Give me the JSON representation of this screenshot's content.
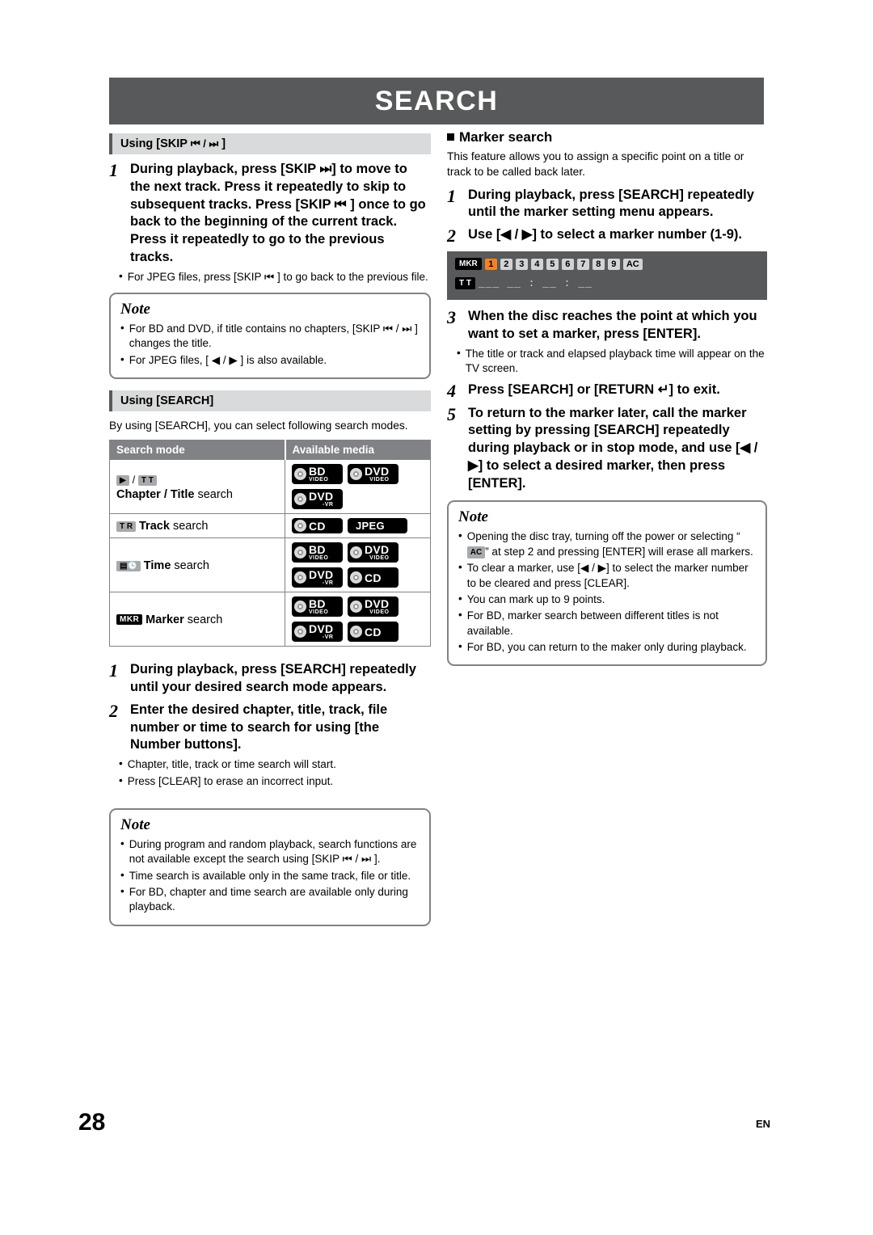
{
  "page": {
    "title": "SEARCH",
    "number": "28",
    "lang": "EN"
  },
  "left": {
    "section1": {
      "heading_prefix": "Using [SKIP",
      "heading_icons": "⏮ / ⏭",
      "heading_suffix": "]",
      "step1_num": "1",
      "step1_text": "During playback, press [SKIP ⏭] to move to the next track. Press it repeatedly to skip to subsequent tracks. Press [SKIP ⏮ ] once to go back to the beginning of the current track. Press it repeatedly to go to the previous tracks.",
      "bullet1": "For JPEG files, press [SKIP ⏮ ] to go back to the previous file.",
      "note_title": "Note",
      "note_b1": "For BD and DVD, if title contains no chapters, [SKIP ⏮ / ⏭ ] changes the title.",
      "note_b2": "For JPEG files, [ ◀ / ▶ ] is also available."
    },
    "section2": {
      "heading": "Using [SEARCH]",
      "intro": "By using [SEARCH], you can select following search modes.",
      "table": {
        "col1": "Search mode",
        "col2": "Available media",
        "rows": [
          {
            "icons": [
              "play",
              "TT"
            ],
            "label_bold": "Chapter / Title",
            "label_norm": "search",
            "media": [
              {
                "type": "disc",
                "big": "BD",
                "sub": "VIDEO"
              },
              {
                "type": "disc",
                "big": "DVD",
                "sub": "VIDEO"
              },
              {
                "type": "disc",
                "big": "DVD",
                "sub": "-VR"
              }
            ]
          },
          {
            "icons": [
              "TR"
            ],
            "label_bold": "Track",
            "label_norm": "search",
            "media": [
              {
                "type": "disc",
                "big": "CD",
                "sub": ""
              },
              {
                "type": "plain",
                "big": "JPEG",
                "sub": ""
              }
            ]
          },
          {
            "icons": [
              "time"
            ],
            "label_bold": "Time",
            "label_norm": "search",
            "media": [
              {
                "type": "disc",
                "big": "BD",
                "sub": "VIDEO"
              },
              {
                "type": "disc",
                "big": "DVD",
                "sub": "VIDEO"
              },
              {
                "type": "disc",
                "big": "DVD",
                "sub": "-VR"
              },
              {
                "type": "disc",
                "big": "CD",
                "sub": ""
              }
            ]
          },
          {
            "icons": [
              "MKR"
            ],
            "label_bold": "Marker",
            "label_norm": "search",
            "media": [
              {
                "type": "disc",
                "big": "BD",
                "sub": "VIDEO"
              },
              {
                "type": "disc",
                "big": "DVD",
                "sub": "VIDEO"
              },
              {
                "type": "disc",
                "big": "DVD",
                "sub": "-VR"
              },
              {
                "type": "disc",
                "big": "CD",
                "sub": ""
              }
            ]
          }
        ]
      },
      "step1_num": "1",
      "step1_text": "During playback, press [SEARCH] repeatedly until your desired search mode appears.",
      "step2_num": "2",
      "step2_text": "Enter the desired chapter, title, track, file number or time to search for using [the Number buttons].",
      "bullet1": "Chapter, title, track or time search will start.",
      "bullet2": "Press [CLEAR] to erase an incorrect input.",
      "note_title": "Note",
      "note_b1": "During program and random playback, search functions are not available except the search using [SKIP ⏮ / ⏭ ].",
      "note_b2": "Time search is available only in the same track, file or title.",
      "note_b3": "For BD, chapter and time search are available only during playback."
    }
  },
  "right": {
    "heading": "Marker search",
    "intro": "This feature allows you to assign a specific point on a title or track to be called back later.",
    "step1_num": "1",
    "step1_text": "During playback, press [SEARCH] repeatedly until the marker setting menu appears.",
    "step2_num": "2",
    "step2_text": "Use [◀ / ▶] to select a marker number (1-9).",
    "strip": {
      "tag_top": "MKR",
      "tag_bottom": "T T",
      "numbers": [
        "1",
        "2",
        "3",
        "4",
        "5",
        "6",
        "7",
        "8",
        "9"
      ],
      "selected": "1",
      "ac_label": "AC",
      "time_row": "___ __ : __ : __"
    },
    "step3_num": "3",
    "step3_text": "When the disc reaches the point at which you want to set a marker, press [ENTER].",
    "step3_bullet": "The title or track and elapsed playback time will appear on the TV screen.",
    "step4_num": "4",
    "step4_text": "Press [SEARCH] or [RETURN ↵] to exit.",
    "step5_num": "5",
    "step5_text": "To return to the marker later, call the marker setting by pressing [SEARCH] repeatedly during playback or in stop mode, and use [◀ / ▶] to select a desired marker, then press [ENTER].",
    "note_title": "Note",
    "note_b1_pre": "Opening the disc tray, turning off the power or selecting “",
    "note_b1_badge": "AC",
    "note_b1_post": "” at step 2 and pressing [ENTER] will erase all markers.",
    "note_b2": "To clear a marker, use [◀ / ▶] to select the marker number to be cleared and press [CLEAR].",
    "note_b3": "You can mark up to 9 points.",
    "note_b4": "For BD, marker search between different titles is not available.",
    "note_b5": "For BD, you can return to the maker only during playback."
  }
}
